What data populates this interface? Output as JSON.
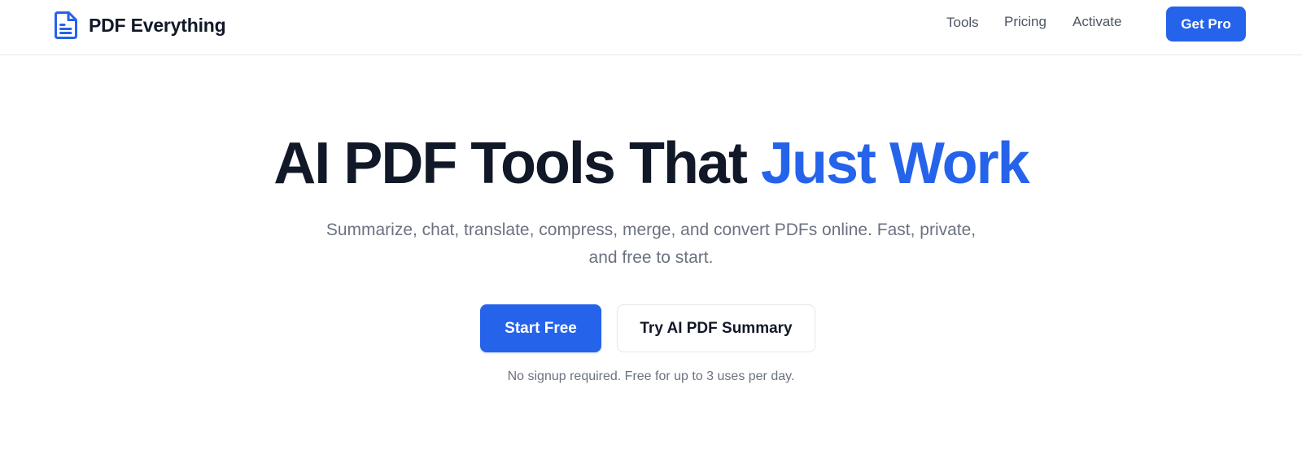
{
  "nav": {
    "brand": "PDF Everything",
    "brand_icon": "document-icon",
    "links": [
      "Tools",
      "Pricing",
      "Activate"
    ],
    "cta": "Get Pro"
  },
  "hero": {
    "title_main": "AI PDF Tools That ",
    "title_accent": "Just Work",
    "subtitle": "Summarize, chat, translate, compress, merge, and convert PDFs online. Fast, private, and free to start.",
    "primary_button": "Start Free",
    "secondary_button": "Try AI PDF Summary",
    "note": "No signup required. Free for up to 3 uses per day."
  },
  "colors": {
    "accent": "#2563eb",
    "heading": "#111827",
    "muted": "#6b7280",
    "border": "#e5e7eb"
  }
}
